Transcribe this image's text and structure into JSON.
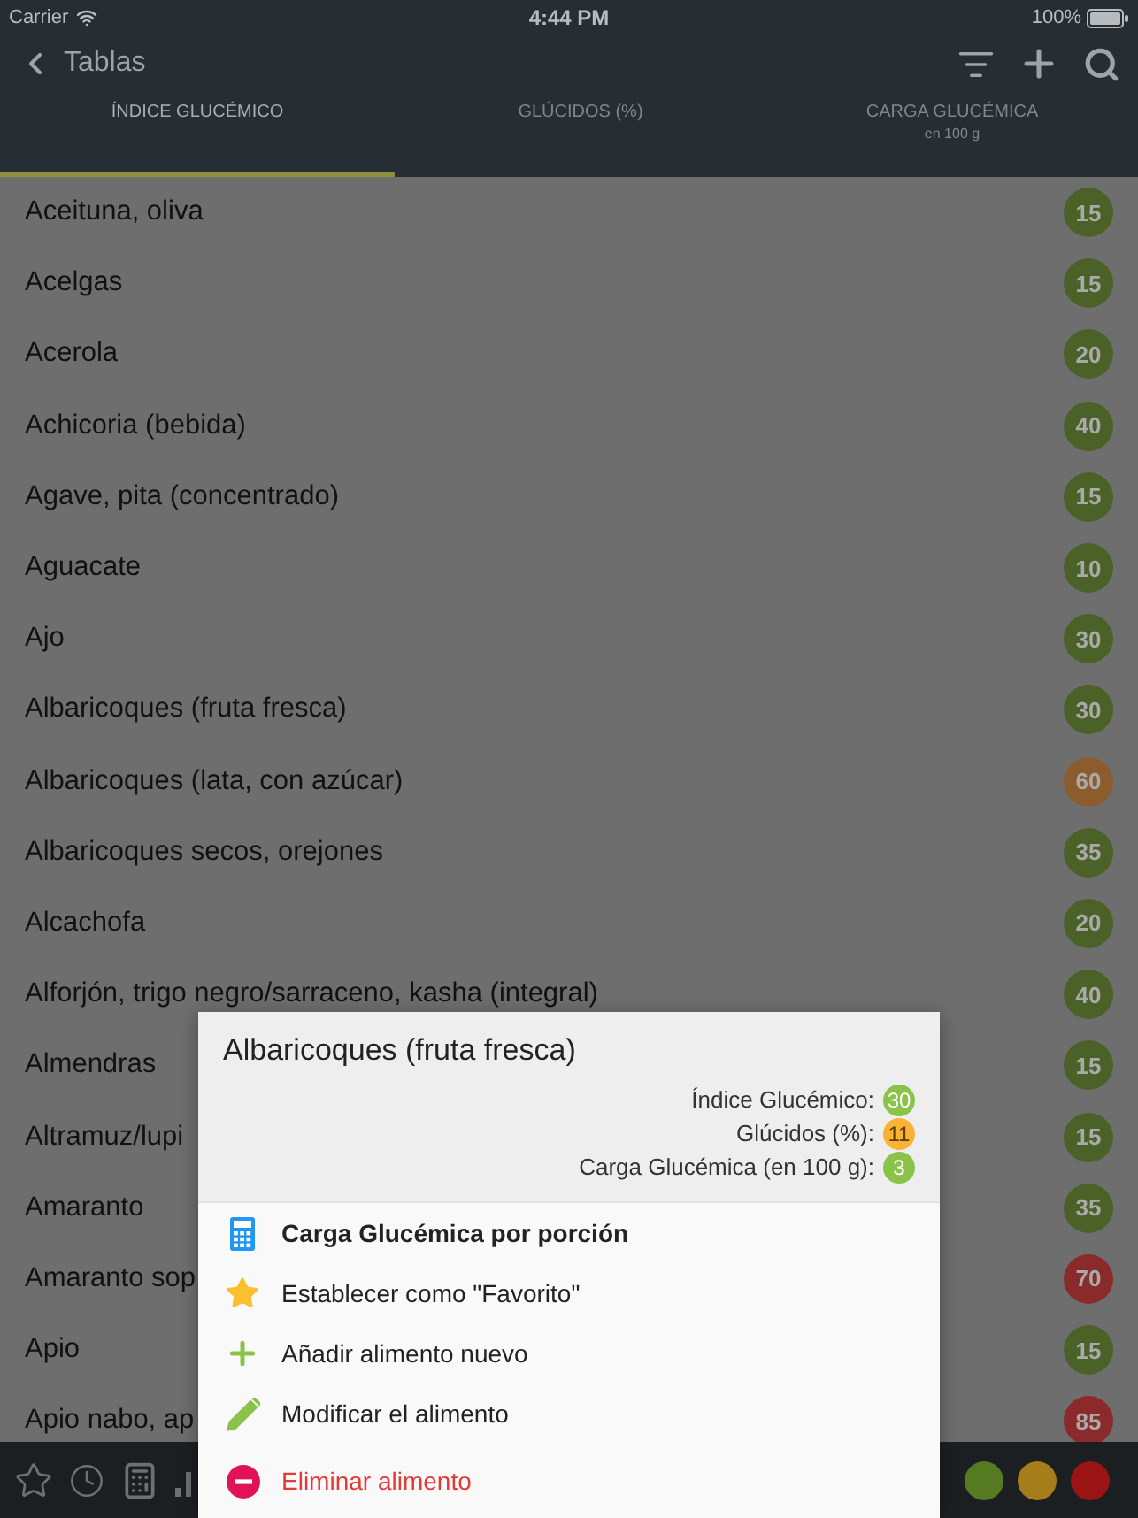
{
  "status_bar": {
    "carrier": "Carrier",
    "time": "4:44 PM",
    "battery": "100%"
  },
  "nav_bar": {
    "back_label": "Tablas"
  },
  "tabs": [
    {
      "label": "ÍNDICE GLUCÉMICO",
      "selected": true
    },
    {
      "label": "GLÚCIDOS (%)",
      "selected": false
    },
    {
      "label": "CARGA GLUCÉMICA",
      "sublabel": "en 100 g",
      "selected": false
    }
  ],
  "foods": [
    {
      "name": "Aceituna, oliva",
      "value": "15",
      "color": "#4a6227"
    },
    {
      "name": "Acelgas",
      "value": "15",
      "color": "#4a6227"
    },
    {
      "name": "Acerola",
      "value": "20",
      "color": "#4a6227"
    },
    {
      "name": "Achicoria (bebida)",
      "value": "40",
      "color": "#4a6227"
    },
    {
      "name": "Agave, pita (concentrado)",
      "value": "15",
      "color": "#4a6227"
    },
    {
      "name": "Aguacate",
      "value": "10",
      "color": "#4a6227"
    },
    {
      "name": "Ajo",
      "value": "30",
      "color": "#4a6227"
    },
    {
      "name": "Albaricoques (fruta fresca)",
      "value": "30",
      "color": "#4a6227"
    },
    {
      "name": "Albaricoques (lata, con azúcar)",
      "value": "60",
      "color": "#8c5c2c"
    },
    {
      "name": "Albaricoques secos, orejones",
      "value": "35",
      "color": "#4a6227"
    },
    {
      "name": "Alcachofa",
      "value": "20",
      "color": "#4a6227"
    },
    {
      "name": "Alforjón, trigo negro/sarraceno, kasha (integral)",
      "value": "40",
      "color": "#4a6227"
    },
    {
      "name": "Almendras",
      "value": "15",
      "color": "#4a6227"
    },
    {
      "name": "Altramuz/lupi",
      "value": "15",
      "color": "#4a6227"
    },
    {
      "name": "Amaranto",
      "value": "35",
      "color": "#4a6227"
    },
    {
      "name": "Amaranto sop",
      "value": "70",
      "color": "#8a2a2a"
    },
    {
      "name": "Apio",
      "value": "15",
      "color": "#4a6227"
    },
    {
      "name": "Apio nabo, ap",
      "value": "85",
      "color": "#8a2a2a"
    }
  ],
  "color_filters": [
    {
      "color": "#557a22"
    },
    {
      "color": "#a77d1c"
    },
    {
      "color": "#9a1414"
    }
  ],
  "dialog": {
    "title": "Albaricoques (fruta fresca)",
    "values": [
      {
        "label": "Índice Glucémico:",
        "value": "30",
        "color": "#8bc34a"
      },
      {
        "label": "Glúcidos (%):",
        "value": "11",
        "color": "#f9b233"
      },
      {
        "label": "Carga Glucémica (en 100 g):",
        "value": "3",
        "color": "#8bc34a"
      }
    ],
    "actions": [
      {
        "label": "Carga Glucémica por porción",
        "kind": "calculator",
        "emphasized": true
      },
      {
        "label": "Establecer como \"Favorito\"",
        "kind": "favorite",
        "emphasized": false
      },
      {
        "label": "Añadir alimento nuevo",
        "kind": "add",
        "emphasized": false
      },
      {
        "label": "Modificar el alimento",
        "kind": "edit",
        "emphasized": false
      },
      {
        "label": "Eliminar alimento",
        "kind": "delete",
        "emphasized": false
      }
    ]
  }
}
